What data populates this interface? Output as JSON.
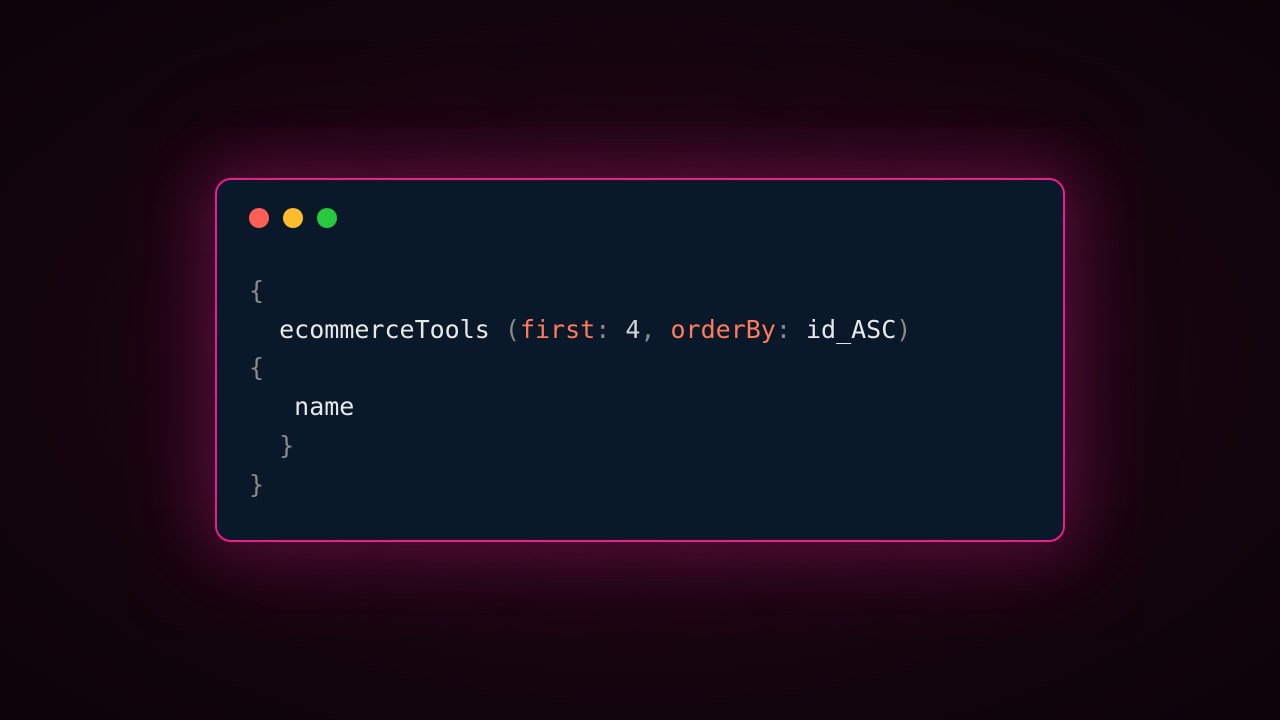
{
  "code": {
    "tokens": [
      {
        "cls": "tok-punct",
        "text": "{"
      },
      {
        "cls": "",
        "text": "\n  "
      },
      {
        "cls": "tok-ident",
        "text": "ecommerceTools "
      },
      {
        "cls": "tok-punct",
        "text": "("
      },
      {
        "cls": "tok-keyword",
        "text": "first"
      },
      {
        "cls": "tok-punct",
        "text": ": "
      },
      {
        "cls": "tok-num",
        "text": "4"
      },
      {
        "cls": "tok-punct",
        "text": ", "
      },
      {
        "cls": "tok-keyword",
        "text": "orderBy"
      },
      {
        "cls": "tok-punct",
        "text": ": "
      },
      {
        "cls": "tok-ident",
        "text": "id_ASC"
      },
      {
        "cls": "tok-punct",
        "text": ")"
      },
      {
        "cls": "",
        "text": "\n"
      },
      {
        "cls": "tok-punct",
        "text": "{"
      },
      {
        "cls": "",
        "text": "\n   "
      },
      {
        "cls": "tok-ident",
        "text": "name"
      },
      {
        "cls": "",
        "text": "\n  "
      },
      {
        "cls": "tok-punct",
        "text": "}"
      },
      {
        "cls": "",
        "text": "\n"
      },
      {
        "cls": "tok-punct",
        "text": "}"
      }
    ]
  },
  "window": {
    "traffic_lights": [
      "close",
      "minimize",
      "maximize"
    ]
  }
}
